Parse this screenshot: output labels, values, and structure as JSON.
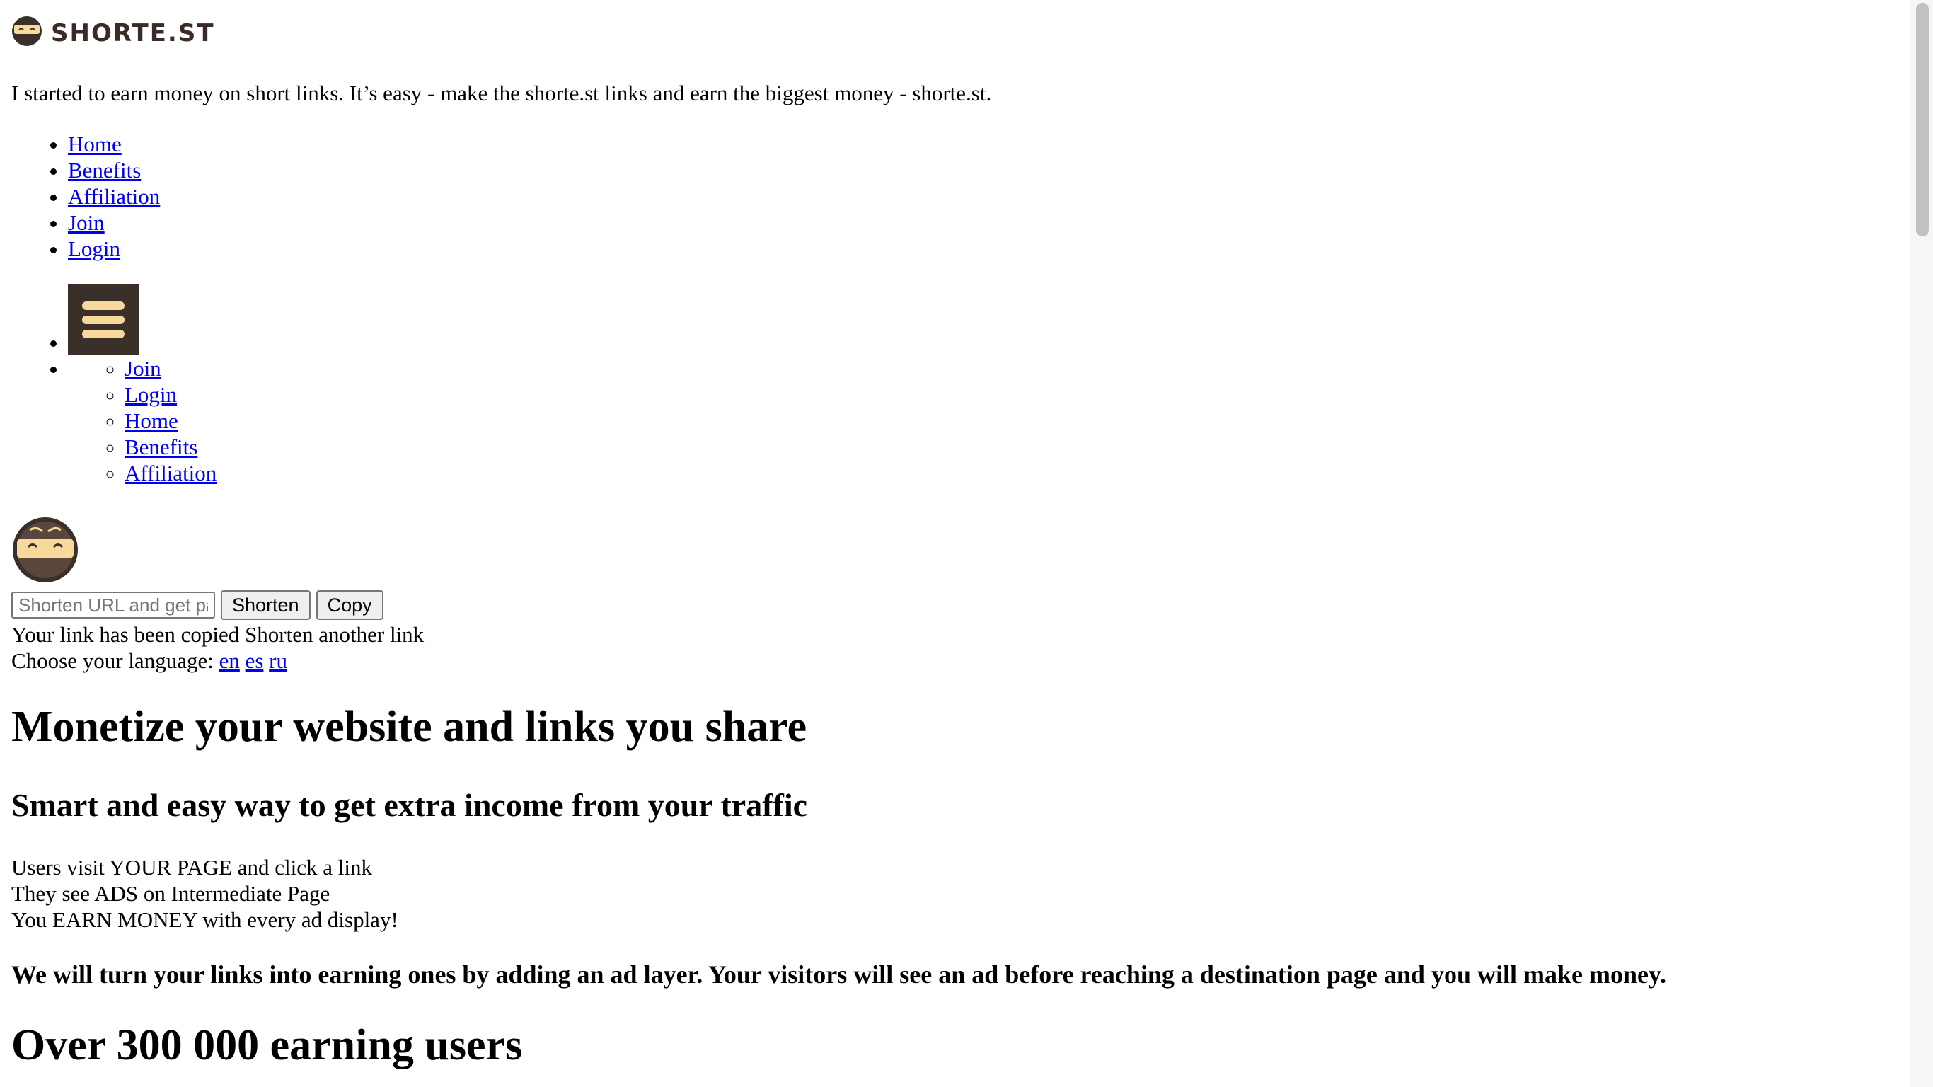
{
  "logo": {
    "wordmark": "SHORTE.ST",
    "icon": "ninja-icon"
  },
  "tagline": "I started to earn money on short links. It’s easy - make the shorte.st links and earn the biggest money - shorte.st.",
  "nav": {
    "items": [
      {
        "label": "Home"
      },
      {
        "label": "Benefits"
      },
      {
        "label": "Affiliation"
      },
      {
        "label": "Join"
      },
      {
        "label": "Login"
      }
    ]
  },
  "menu": {
    "icon": "hamburger-menu-icon",
    "items": [
      {
        "label": "Join"
      },
      {
        "label": "Login"
      },
      {
        "label": "Home"
      },
      {
        "label": "Benefits"
      },
      {
        "label": "Affiliation"
      }
    ]
  },
  "mascot": {
    "icon": "ninja-mascot-icon"
  },
  "shortener": {
    "placeholder": "Shorten URL and get paid",
    "shorten_label": "Shorten",
    "copy_label": "Copy",
    "copied_text": "Your link has been copied",
    "another_text": "Shorten another link"
  },
  "language": {
    "prompt": "Choose your language:",
    "options": [
      "en",
      "es",
      "ru"
    ]
  },
  "hero": {
    "title": "Monetize your website and links you share",
    "subtitle": "Smart and easy way to get extra income from your traffic",
    "steps": [
      "Users visit YOUR PAGE and click a link",
      "They see ADS on Intermediate Page",
      "You EARN MONEY with every ad display!"
    ],
    "explanation": "We will turn your links into earning ones by adding an ad layer. Your visitors will see an ad before reaching a destination page and you will make money.",
    "users_heading": "Over 300 000 earning users"
  },
  "colors": {
    "brand_dark": "#3a2f29",
    "brand_cream": "#f7d99b",
    "link": "#0000ee"
  }
}
